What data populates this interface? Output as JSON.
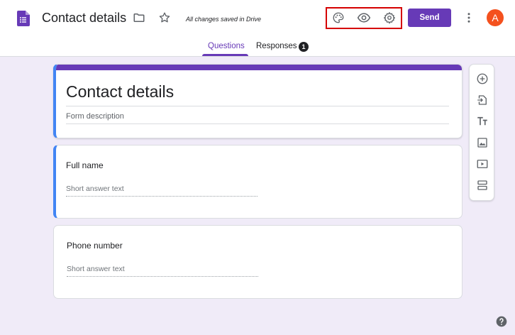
{
  "header": {
    "title": "Contact details",
    "saved_status": "All changes saved in Drive",
    "send_label": "Send",
    "avatar_letter": "A"
  },
  "icons": {
    "app": "forms-icon",
    "folder": "folder-icon",
    "star": "star-icon",
    "palette": "palette-icon",
    "preview": "eye-icon",
    "settings": "gear-icon",
    "more": "more-vert-icon",
    "help": "help-icon"
  },
  "tabs": [
    {
      "label": "Questions",
      "active": true
    },
    {
      "label": "Responses",
      "badge": "1"
    }
  ],
  "form": {
    "title": "Contact details",
    "description_placeholder": "Form description"
  },
  "questions": [
    {
      "title": "Full name",
      "answer_placeholder": "Short answer text"
    },
    {
      "title": "Phone number",
      "answer_placeholder": "Short answer text"
    }
  ],
  "toolbar": [
    "add-question-icon",
    "import-questions-icon",
    "add-title-icon",
    "add-image-icon",
    "add-video-icon",
    "add-section-icon"
  ],
  "colors": {
    "accent": "#673ab7",
    "active_border": "#4285f4",
    "background": "#f0ebf8",
    "avatar": "#f4511e",
    "highlight": "#d50000"
  }
}
